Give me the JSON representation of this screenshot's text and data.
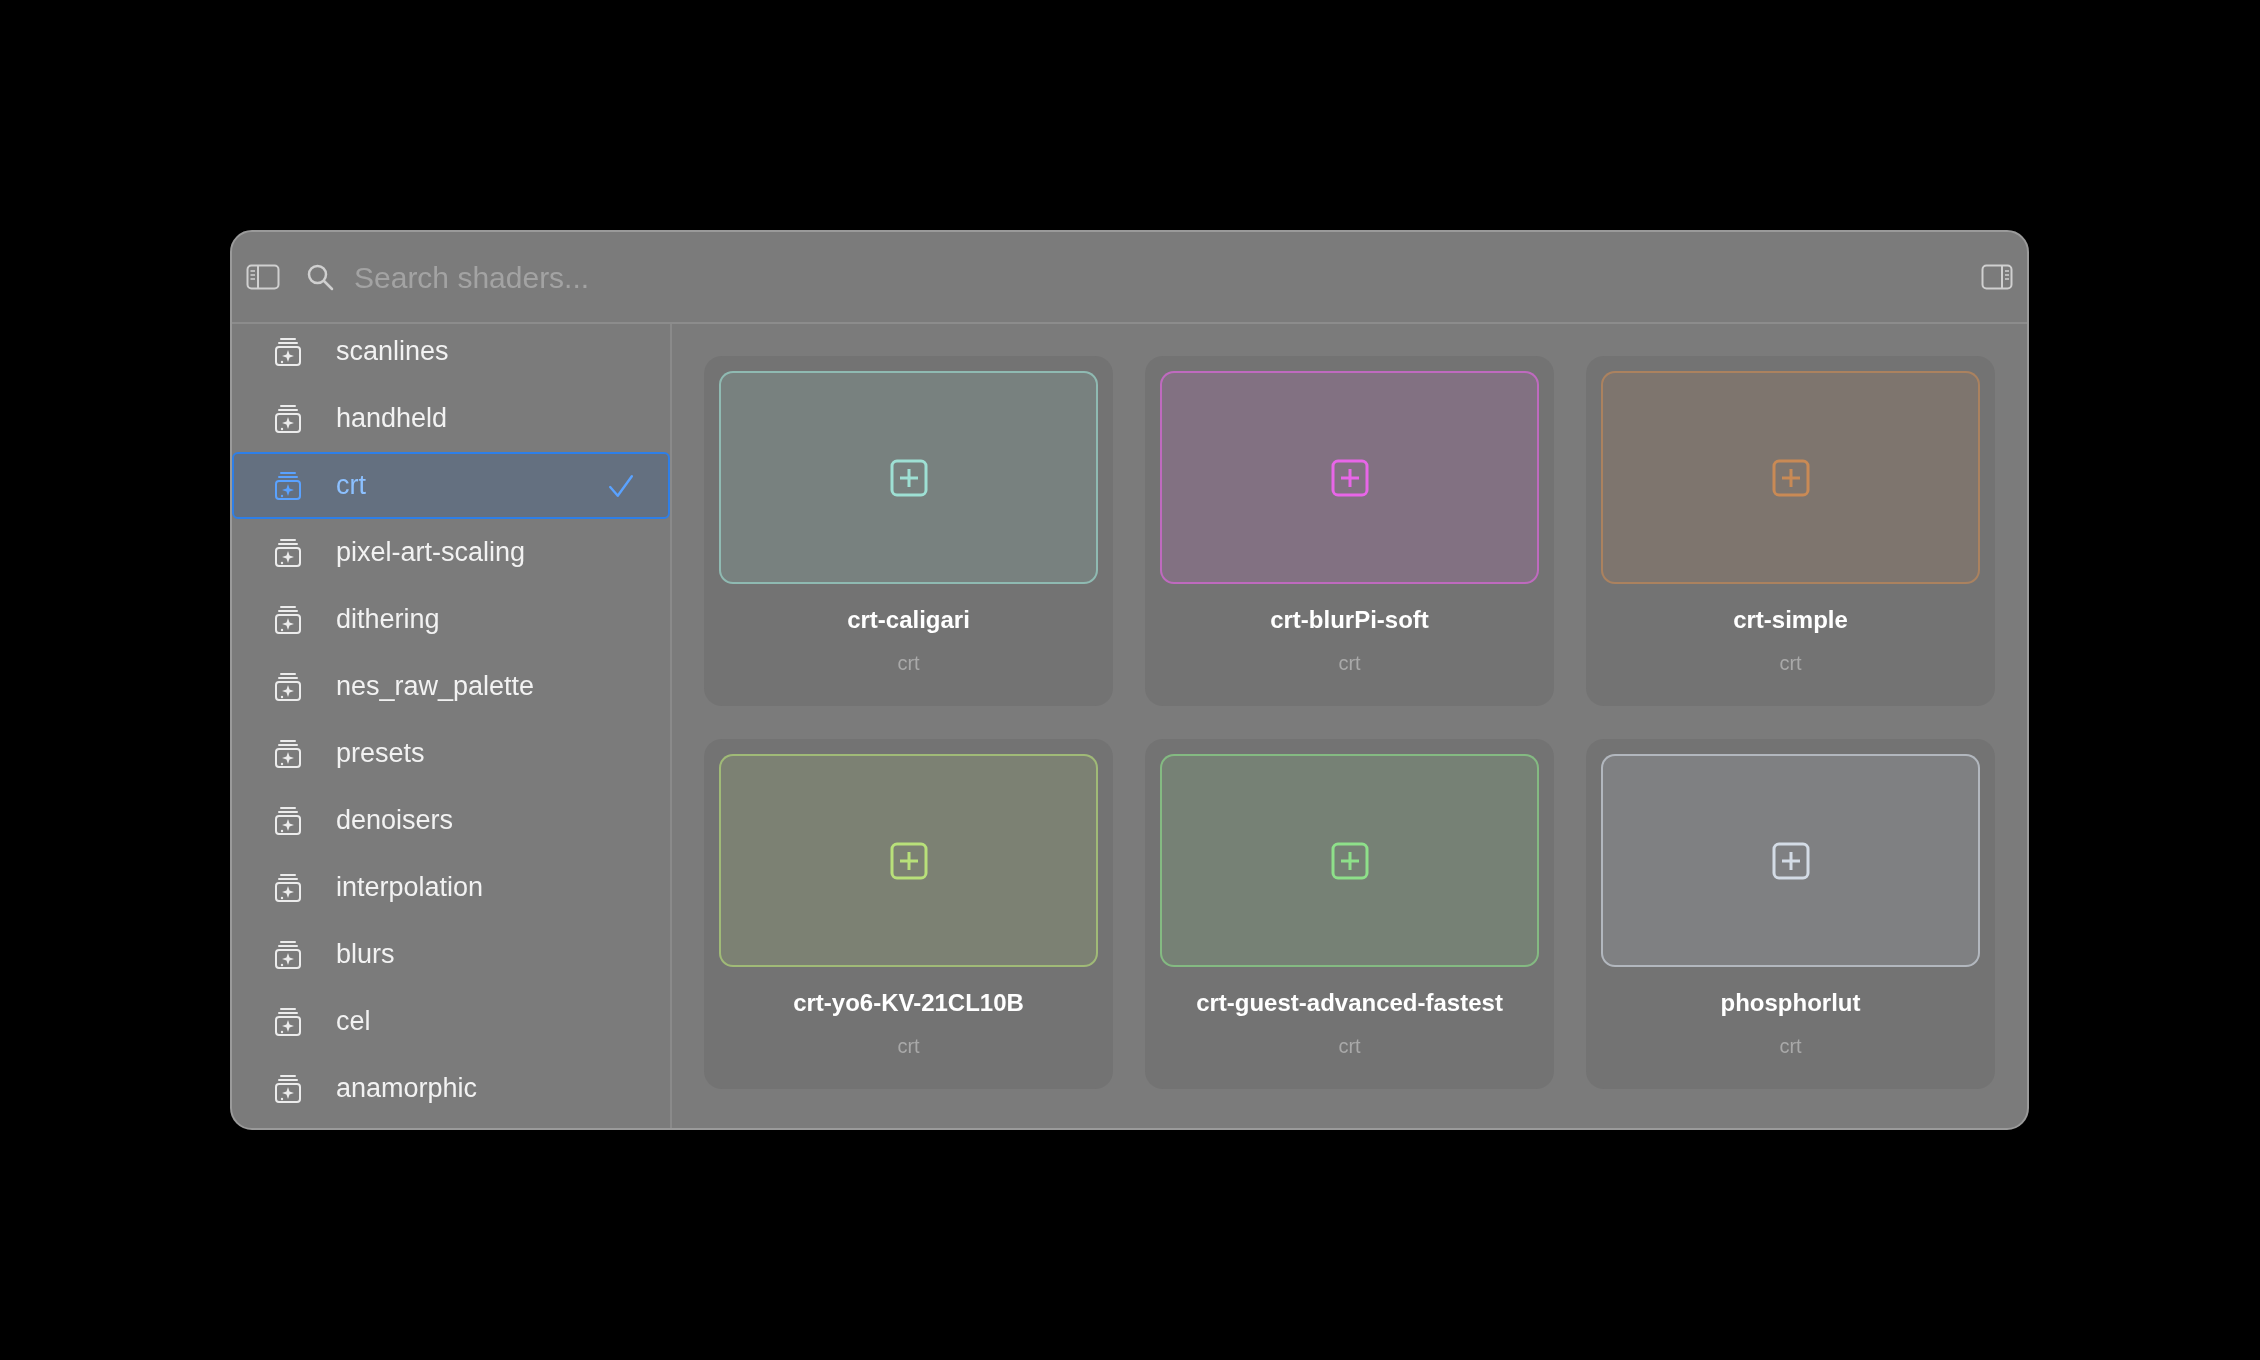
{
  "search": {
    "placeholder": "Search shaders..."
  },
  "sidebar": {
    "items": [
      {
        "label": "scanlines",
        "selected": false
      },
      {
        "label": "handheld",
        "selected": false
      },
      {
        "label": "crt",
        "selected": true
      },
      {
        "label": "pixel-art-scaling",
        "selected": false
      },
      {
        "label": "dithering",
        "selected": false
      },
      {
        "label": "nes_raw_palette",
        "selected": false
      },
      {
        "label": "presets",
        "selected": false
      },
      {
        "label": "denoisers",
        "selected": false
      },
      {
        "label": "interpolation",
        "selected": false
      },
      {
        "label": "blurs",
        "selected": false
      },
      {
        "label": "cel",
        "selected": false
      },
      {
        "label": "anamorphic",
        "selected": false
      }
    ]
  },
  "shaders": [
    {
      "name": "crt-caligari",
      "category": "crt",
      "color": "#9ee0d4"
    },
    {
      "name": "crt-blurPi-soft",
      "category": "crt",
      "color": "#e866e8"
    },
    {
      "name": "crt-simple",
      "category": "crt",
      "color": "#c98a55"
    },
    {
      "name": "crt-yo6-KV-21CL10B",
      "category": "crt",
      "color": "#b8e07a"
    },
    {
      "name": "crt-guest-advanced-fastest",
      "category": "crt",
      "color": "#8ee08a"
    },
    {
      "name": "phosphorlut",
      "category": "crt",
      "color": "#d4dce6"
    }
  ]
}
